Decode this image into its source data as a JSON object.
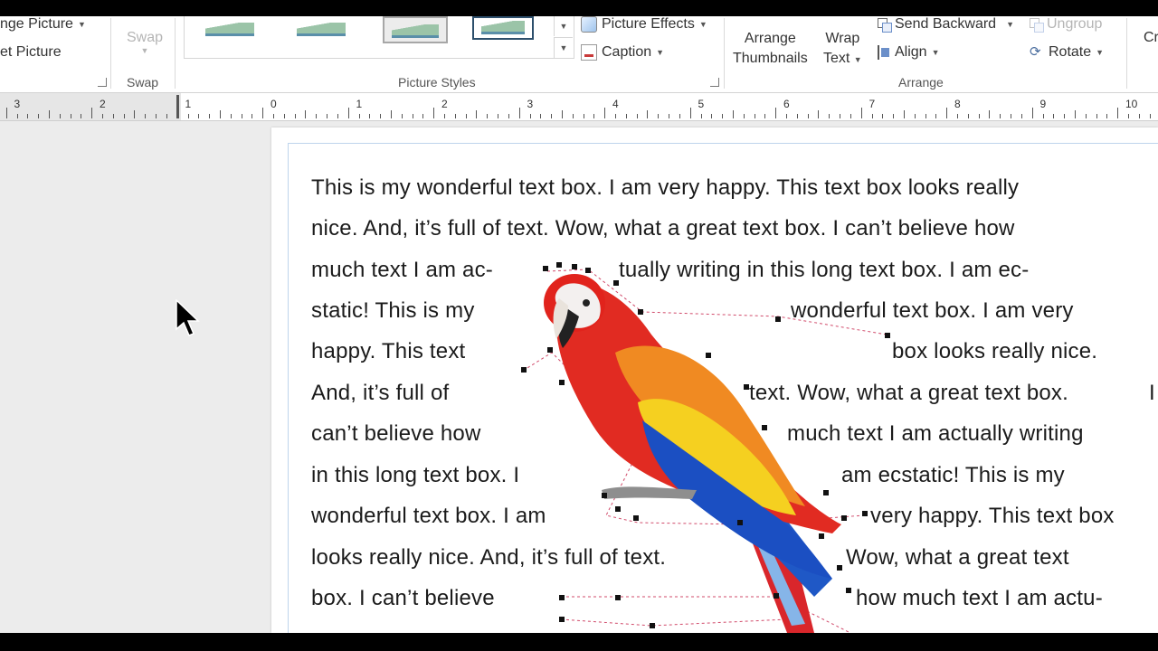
{
  "ribbon": {
    "change_picture": "nge Picture",
    "reset_picture": "et Picture",
    "swap_button": "Swap",
    "swap_group": "Swap",
    "picture_styles_group": "Picture Styles",
    "picture_effects": "Picture Effects",
    "caption": "Caption",
    "arrange_thumbnails_line1": "Arrange",
    "arrange_thumbnails_line2": "Thumbnails",
    "wrap_text_line1": "Wrap",
    "wrap_text_line2": "Text",
    "send_backward": "Send Backward",
    "align": "Align",
    "ungroup": "Ungroup",
    "rotate": "Rotate",
    "crop_partial": "Cr",
    "arrange_group": "Arrange"
  },
  "ruler": {
    "labels": [
      "3",
      "2",
      "1",
      "0",
      "1",
      "2",
      "3",
      "4",
      "5",
      "6",
      "7",
      "8",
      "9",
      "10"
    ]
  },
  "document": {
    "lines": [
      "This is my wonderful text box. I am very happy. This text box looks really",
      "nice. And, it’s full of text. Wow, what a great text box.   I can’t believe how",
      "much text I am ac-",
      "tually writing in this long text box.  I am ec-",
      "static!  This is my",
      "wonderful text box. I am very",
      "happy. This text",
      "box looks really nice.",
      "And, it’s full of",
      "text. Wow, what a great text box.",
      "I",
      "can’t believe how",
      "much text I am actually writing",
      "in this long text box.  I",
      "am ecstatic!  This is my",
      "wonderful text box. I am",
      "very happy. This text box",
      "looks really nice. And, it’s full of text.",
      "Wow, what a great text",
      "box.   I can’t believe",
      "how much text I am actu-"
    ]
  },
  "picture": {
    "icon": "parrot-picture"
  }
}
